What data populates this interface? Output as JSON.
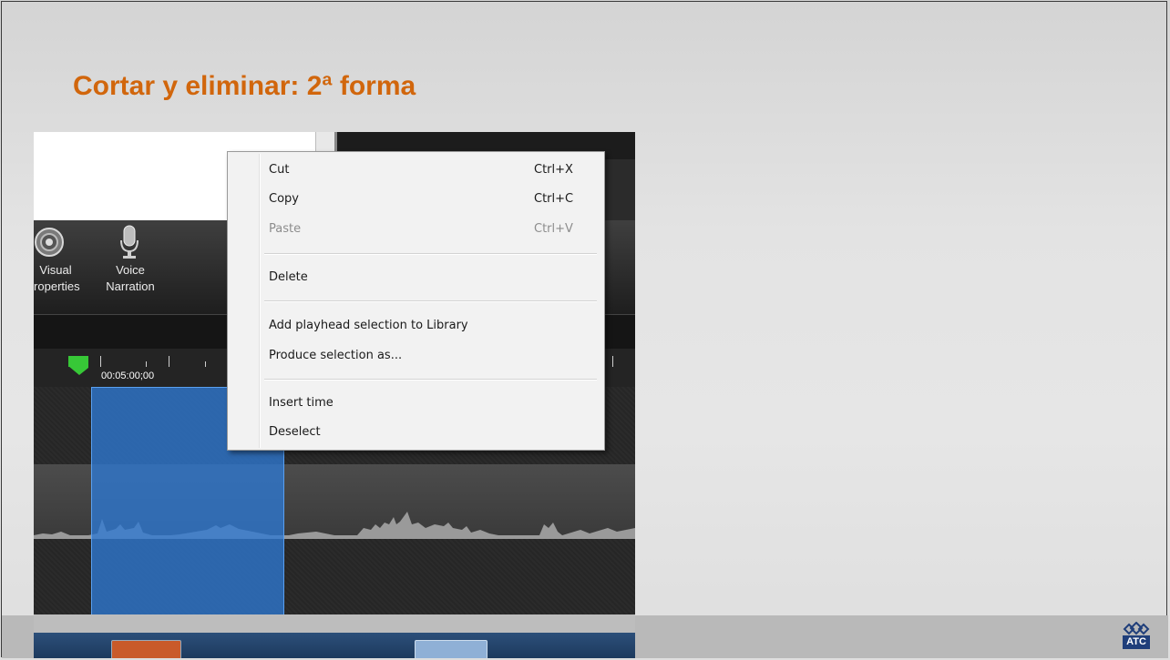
{
  "slide": {
    "title": "Cortar y eliminar: 2ª forma"
  },
  "toolbar": {
    "visual_properties_line1": "Visual",
    "visual_properties_line2": "Properties",
    "voice_narration_line1": "Voice",
    "voice_narration_line2": "Narration"
  },
  "timeline": {
    "timecode": "00:05:00;00"
  },
  "context_menu": {
    "items": [
      {
        "label": "Cut",
        "shortcut": "Ctrl+X",
        "enabled": true
      },
      {
        "label": "Copy",
        "shortcut": "Ctrl+C",
        "enabled": true
      },
      {
        "label": "Paste",
        "shortcut": "Ctrl+V",
        "enabled": false
      },
      {
        "label": "Delete",
        "shortcut": "",
        "enabled": true
      },
      {
        "label": "Add playhead selection to Library",
        "shortcut": "",
        "enabled": true
      },
      {
        "label": "Produce selection as...",
        "shortcut": "",
        "enabled": true
      },
      {
        "label": "Insert time",
        "shortcut": "",
        "enabled": true
      },
      {
        "label": "Deselect",
        "shortcut": "",
        "enabled": true
      }
    ]
  },
  "logo": {
    "text": "ATC"
  },
  "colors": {
    "title": "#d1660c",
    "selection": "#2e78d2",
    "playhead": "#37c837"
  }
}
